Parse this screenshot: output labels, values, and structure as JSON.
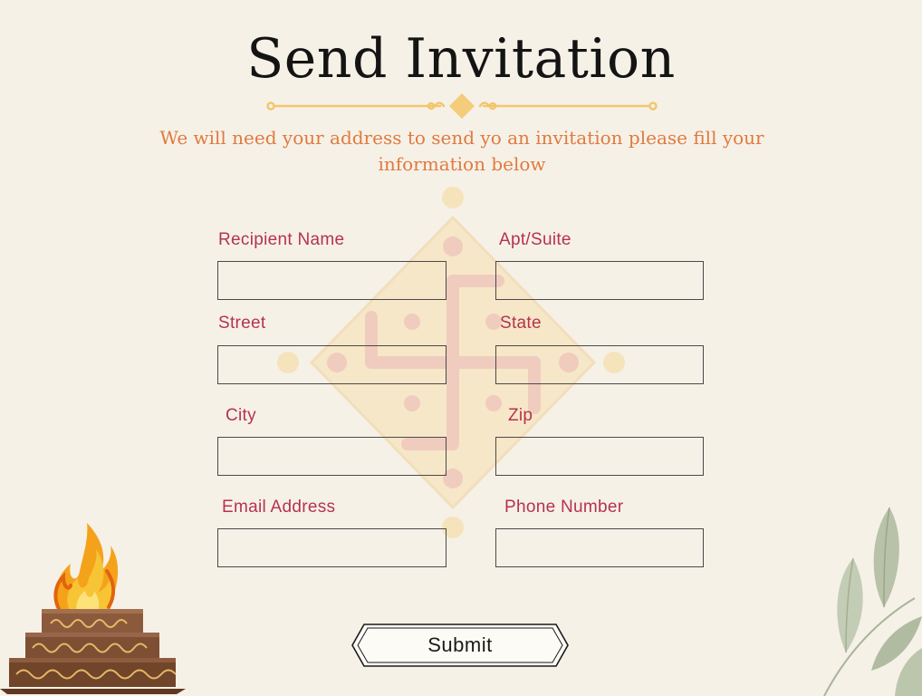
{
  "header": {
    "title": "Send Invitation",
    "subtitle_line1": "We will need your address to send yo an invitation please fill your",
    "subtitle_line2": "information below"
  },
  "form": {
    "fields": [
      {
        "label": "Recipient Name",
        "value": ""
      },
      {
        "label": "Apt/Suite",
        "value": ""
      },
      {
        "label": "Street",
        "value": ""
      },
      {
        "label": "State",
        "value": ""
      },
      {
        "label": "City",
        "value": ""
      },
      {
        "label": "Zip",
        "value": ""
      },
      {
        "label": "Email Address",
        "value": ""
      },
      {
        "label": "Phone Number",
        "value": ""
      }
    ],
    "submit_label": "Submit"
  },
  "colors": {
    "background": "#f6f1e7",
    "title": "#141414",
    "subtitle": "#e07a3f",
    "label": "#b5334f",
    "divider": "#f2c66d"
  },
  "icons": [
    "ornament-divider",
    "swastika-watermark",
    "havan-fire-icon",
    "leaf-branch-decoration"
  ]
}
